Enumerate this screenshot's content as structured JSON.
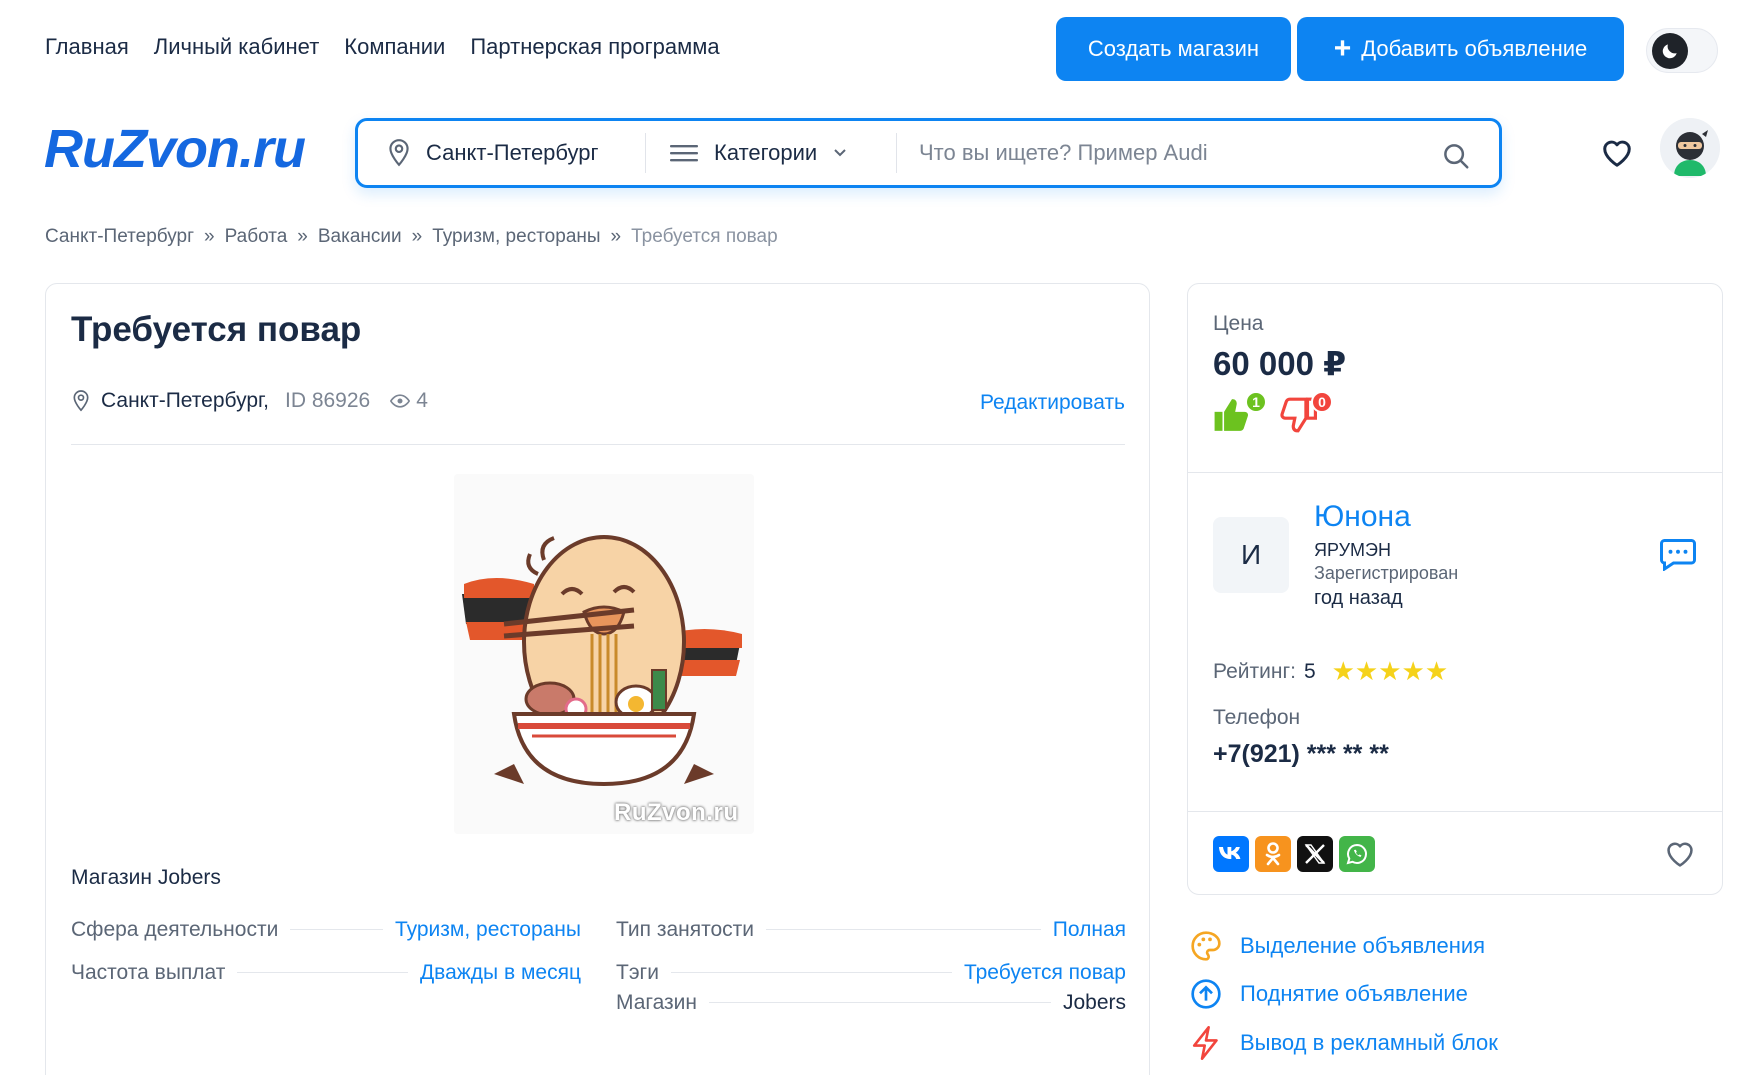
{
  "topnav": {
    "links": [
      "Главная",
      "Личный кабинет",
      "Компании",
      "Партнерская программа"
    ],
    "create_shop": "Создать магазин",
    "add_listing": "Добавить объявление"
  },
  "logo": "RuZvon.ru",
  "search": {
    "city": "Санкт-Петербург",
    "categories": "Категории",
    "placeholder": "Что вы ищете? Пример Audi",
    "value": ""
  },
  "breadcrumb": [
    "Санкт-Петербург",
    "Работа",
    "Вакансии",
    "Туризм, рестораны",
    "Требуется повар"
  ],
  "breadcrumb_sep": "»",
  "listing": {
    "title": "Требуется повар",
    "city": "Санкт-Петербург,",
    "id": "ID 86926",
    "views": "4",
    "edit": "Редактировать",
    "watermark": "RuZvon.ru",
    "shop_line": "Магазин Jobers",
    "props": {
      "sphere_k": "Сфера деятельности",
      "sphere_v": "Туризм, рестораны",
      "freq_k": "Частота выплат",
      "freq_v": "Дважды в месяц",
      "type_k": "Тип занятости",
      "type_v": "Полная",
      "tags_k": "Тэги",
      "tags_v": "Требуется повар",
      "shop_k": "Магазин",
      "shop_v": "Jobers"
    }
  },
  "side": {
    "price_label": "Цена",
    "price": "60 000 ₽",
    "likes": "1",
    "dislikes": "0",
    "seller_initial": "И",
    "seller_name": "Юнона",
    "seller_shop": "ЯРУМЭН",
    "seller_reg": "Зарегистрирован",
    "seller_ago": "год назад",
    "rating_label": "Рейтинг:",
    "rating": "5",
    "stars": "★★★★★",
    "phone_label": "Телефон",
    "phone": "+7(921) *** ** **",
    "shares": [
      "VK",
      "OK",
      "X",
      "WhatsApp"
    ]
  },
  "promo": [
    "Выделение объявления",
    "Поднятие объявление",
    "Вывод в рекламный блок"
  ],
  "colors": {
    "accent": "#0d84f2",
    "text": "#1b2b45",
    "like": "#6cc21f",
    "dislike": "#f2453d",
    "star": "#f5d21a"
  }
}
